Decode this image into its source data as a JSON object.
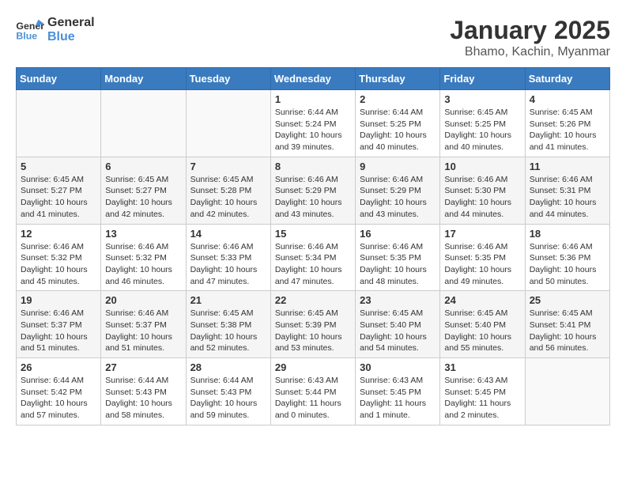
{
  "header": {
    "logo_line1": "General",
    "logo_line2": "Blue",
    "month": "January 2025",
    "location": "Bhamo, Kachin, Myanmar"
  },
  "weekdays": [
    "Sunday",
    "Monday",
    "Tuesday",
    "Wednesday",
    "Thursday",
    "Friday",
    "Saturday"
  ],
  "weeks": [
    [
      {
        "day": "",
        "info": ""
      },
      {
        "day": "",
        "info": ""
      },
      {
        "day": "",
        "info": ""
      },
      {
        "day": "1",
        "info": "Sunrise: 6:44 AM\nSunset: 5:24 PM\nDaylight: 10 hours\nand 39 minutes."
      },
      {
        "day": "2",
        "info": "Sunrise: 6:44 AM\nSunset: 5:25 PM\nDaylight: 10 hours\nand 40 minutes."
      },
      {
        "day": "3",
        "info": "Sunrise: 6:45 AM\nSunset: 5:25 PM\nDaylight: 10 hours\nand 40 minutes."
      },
      {
        "day": "4",
        "info": "Sunrise: 6:45 AM\nSunset: 5:26 PM\nDaylight: 10 hours\nand 41 minutes."
      }
    ],
    [
      {
        "day": "5",
        "info": "Sunrise: 6:45 AM\nSunset: 5:27 PM\nDaylight: 10 hours\nand 41 minutes."
      },
      {
        "day": "6",
        "info": "Sunrise: 6:45 AM\nSunset: 5:27 PM\nDaylight: 10 hours\nand 42 minutes."
      },
      {
        "day": "7",
        "info": "Sunrise: 6:45 AM\nSunset: 5:28 PM\nDaylight: 10 hours\nand 42 minutes."
      },
      {
        "day": "8",
        "info": "Sunrise: 6:46 AM\nSunset: 5:29 PM\nDaylight: 10 hours\nand 43 minutes."
      },
      {
        "day": "9",
        "info": "Sunrise: 6:46 AM\nSunset: 5:29 PM\nDaylight: 10 hours\nand 43 minutes."
      },
      {
        "day": "10",
        "info": "Sunrise: 6:46 AM\nSunset: 5:30 PM\nDaylight: 10 hours\nand 44 minutes."
      },
      {
        "day": "11",
        "info": "Sunrise: 6:46 AM\nSunset: 5:31 PM\nDaylight: 10 hours\nand 44 minutes."
      }
    ],
    [
      {
        "day": "12",
        "info": "Sunrise: 6:46 AM\nSunset: 5:32 PM\nDaylight: 10 hours\nand 45 minutes."
      },
      {
        "day": "13",
        "info": "Sunrise: 6:46 AM\nSunset: 5:32 PM\nDaylight: 10 hours\nand 46 minutes."
      },
      {
        "day": "14",
        "info": "Sunrise: 6:46 AM\nSunset: 5:33 PM\nDaylight: 10 hours\nand 47 minutes."
      },
      {
        "day": "15",
        "info": "Sunrise: 6:46 AM\nSunset: 5:34 PM\nDaylight: 10 hours\nand 47 minutes."
      },
      {
        "day": "16",
        "info": "Sunrise: 6:46 AM\nSunset: 5:35 PM\nDaylight: 10 hours\nand 48 minutes."
      },
      {
        "day": "17",
        "info": "Sunrise: 6:46 AM\nSunset: 5:35 PM\nDaylight: 10 hours\nand 49 minutes."
      },
      {
        "day": "18",
        "info": "Sunrise: 6:46 AM\nSunset: 5:36 PM\nDaylight: 10 hours\nand 50 minutes."
      }
    ],
    [
      {
        "day": "19",
        "info": "Sunrise: 6:46 AM\nSunset: 5:37 PM\nDaylight: 10 hours\nand 51 minutes."
      },
      {
        "day": "20",
        "info": "Sunrise: 6:46 AM\nSunset: 5:37 PM\nDaylight: 10 hours\nand 51 minutes."
      },
      {
        "day": "21",
        "info": "Sunrise: 6:45 AM\nSunset: 5:38 PM\nDaylight: 10 hours\nand 52 minutes."
      },
      {
        "day": "22",
        "info": "Sunrise: 6:45 AM\nSunset: 5:39 PM\nDaylight: 10 hours\nand 53 minutes."
      },
      {
        "day": "23",
        "info": "Sunrise: 6:45 AM\nSunset: 5:40 PM\nDaylight: 10 hours\nand 54 minutes."
      },
      {
        "day": "24",
        "info": "Sunrise: 6:45 AM\nSunset: 5:40 PM\nDaylight: 10 hours\nand 55 minutes."
      },
      {
        "day": "25",
        "info": "Sunrise: 6:45 AM\nSunset: 5:41 PM\nDaylight: 10 hours\nand 56 minutes."
      }
    ],
    [
      {
        "day": "26",
        "info": "Sunrise: 6:44 AM\nSunset: 5:42 PM\nDaylight: 10 hours\nand 57 minutes."
      },
      {
        "day": "27",
        "info": "Sunrise: 6:44 AM\nSunset: 5:43 PM\nDaylight: 10 hours\nand 58 minutes."
      },
      {
        "day": "28",
        "info": "Sunrise: 6:44 AM\nSunset: 5:43 PM\nDaylight: 10 hours\nand 59 minutes."
      },
      {
        "day": "29",
        "info": "Sunrise: 6:43 AM\nSunset: 5:44 PM\nDaylight: 11 hours\nand 0 minutes."
      },
      {
        "day": "30",
        "info": "Sunrise: 6:43 AM\nSunset: 5:45 PM\nDaylight: 11 hours\nand 1 minute."
      },
      {
        "day": "31",
        "info": "Sunrise: 6:43 AM\nSunset: 5:45 PM\nDaylight: 11 hours\nand 2 minutes."
      },
      {
        "day": "",
        "info": ""
      }
    ]
  ]
}
